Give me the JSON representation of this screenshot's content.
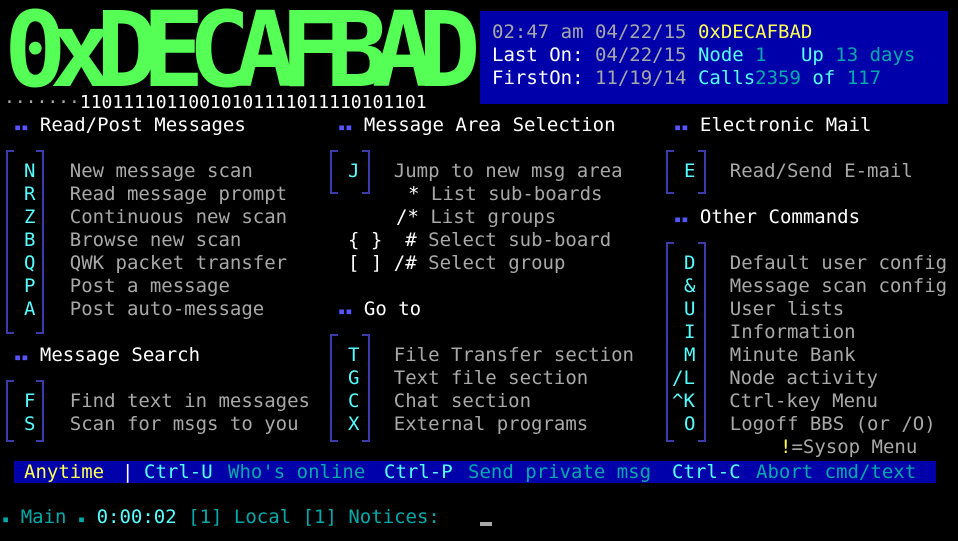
{
  "logo": {
    "text": "0xDECAFBAD",
    "letters": [
      "0",
      "x",
      "D",
      "E",
      "C",
      "A",
      "F",
      "B",
      "A",
      "D"
    ],
    "dots": "·······",
    "binary": "11011110110010101111011110101101"
  },
  "status": {
    "time": "02:47 am",
    "date": "04/22/15",
    "bbs_name": "0xDECAFBAD",
    "last_on_label": "Last On:",
    "last_on_date": "04/22/15",
    "node_label": "Node",
    "node_num": "1",
    "up_label": "Up",
    "up_value": "13 days",
    "first_on_label": "FirstOn:",
    "first_on_date": "11/19/14",
    "calls_label": "Calls",
    "calls_value": "2359",
    "of_label": "of",
    "of_value": "117"
  },
  "sections": {
    "read_post": {
      "title": "Read/Post Messages",
      "items": [
        {
          "key": "N",
          "label": "New message scan"
        },
        {
          "key": "R",
          "label": "Read message prompt"
        },
        {
          "key": "Z",
          "label": "Continuous new scan"
        },
        {
          "key": "B",
          "label": "Browse new scan"
        },
        {
          "key": "Q",
          "label": "QWK packet transfer"
        },
        {
          "key": "P",
          "label": "Post a message"
        },
        {
          "key": "A",
          "label": "Post auto-message"
        }
      ]
    },
    "msg_area": {
      "title": "Message Area Selection",
      "items": [
        {
          "key": "J",
          "label": "Jump to new msg area"
        },
        {
          "key": "*",
          "label": "List sub-boards"
        },
        {
          "key": "/*",
          "label": "List groups"
        },
        {
          "key": "{ }",
          "key2": "#",
          "label": "Select sub-board"
        },
        {
          "key": "[ ]",
          "key2": "/#",
          "label": "Select group"
        }
      ]
    },
    "email": {
      "title": "Electronic Mail",
      "items": [
        {
          "key": "E",
          "label": "Read/Send E-mail"
        }
      ]
    },
    "search": {
      "title": "Message Search",
      "items": [
        {
          "key": "F",
          "label": "Find text in messages"
        },
        {
          "key": "S",
          "label": "Scan for msgs to you"
        }
      ]
    },
    "goto": {
      "title": "Go to",
      "items": [
        {
          "key": "T",
          "label": "File Transfer section"
        },
        {
          "key": "G",
          "label": "Text file section"
        },
        {
          "key": "C",
          "label": "Chat section"
        },
        {
          "key": "X",
          "label": "External programs"
        }
      ]
    },
    "other": {
      "title": "Other Commands",
      "items": [
        {
          "key": "D",
          "label": "Default user config"
        },
        {
          "key": "&",
          "label": "Message scan config"
        },
        {
          "key": "U",
          "label": "User lists"
        },
        {
          "key": "I",
          "label": "Information"
        },
        {
          "key": "M",
          "label": "Minute Bank"
        },
        {
          "key": "/L",
          "label": "Node activity"
        },
        {
          "key": "^K",
          "label": "Ctrl-key Menu"
        },
        {
          "key": "O",
          "label": "Logoff BBS (or /O)"
        }
      ],
      "sysop_key": "!",
      "sysop_label": "=Sysop Menu"
    }
  },
  "anytime_bar": {
    "anytime": "Anytime",
    "sep": "|",
    "ctrl_u": "Ctrl-U",
    "ctrl_u_label": "Who's online",
    "ctrl_p": "Ctrl-P",
    "ctrl_p_label": "Send private msg",
    "ctrl_c": "Ctrl-C",
    "ctrl_c_label": "Abort cmd/text"
  },
  "prompt": {
    "menu": "Main",
    "time": "0:00:02",
    "node_bracket": "[1]",
    "local_label": "Local",
    "local_bracket": "[1]",
    "notices_label": "Notices:"
  },
  "colors": {
    "logo_green": "#55ff55",
    "status_bg": "#0000aa",
    "key_cyan": "#55ffff",
    "bracket_blue": "#3a3aaa"
  }
}
